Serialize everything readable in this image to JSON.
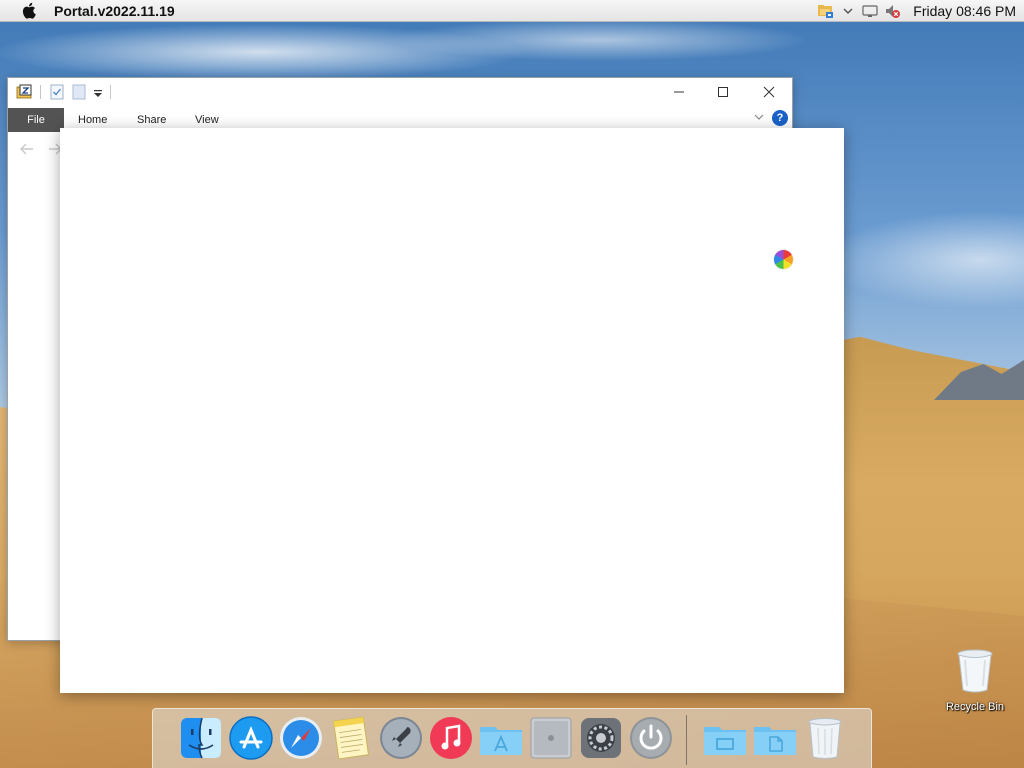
{
  "menubar": {
    "app_title": "Portal.v2022.11.19",
    "clock": "Friday 08:46 PM",
    "tray_icons": [
      "network-folder-icon",
      "chevron-down-icon",
      "display-icon",
      "volume-muted-icon"
    ]
  },
  "explorer": {
    "tabs": {
      "file": "File",
      "home": "Home",
      "share": "Share",
      "view": "View"
    },
    "help_glyph": "?"
  },
  "desktop": {
    "recycle_bin_label": "Recycle Bin"
  },
  "dock": {
    "items": [
      "finder",
      "app-store",
      "safari",
      "notes",
      "launchpad",
      "music",
      "applications-folder",
      "mac-pro",
      "system-preferences",
      "power",
      "documents-folder",
      "downloads-folder",
      "trash"
    ]
  },
  "colors": {
    "file_tab_bg": "#535353",
    "help_blue": "#1a62c9",
    "menubar": "#ececec"
  }
}
